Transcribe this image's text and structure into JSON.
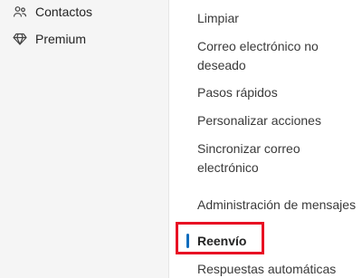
{
  "left_nav": {
    "items": [
      {
        "label": "Contactos",
        "icon": "people-icon"
      },
      {
        "label": "Premium",
        "icon": "diamond-icon"
      }
    ]
  },
  "settings_menu": {
    "items": [
      {
        "label": "Limpiar"
      },
      {
        "label": "Correo electrónico no deseado"
      },
      {
        "label": "Pasos rápidos"
      },
      {
        "label": "Personalizar acciones"
      },
      {
        "label": "Sincronizar correo electrónico"
      },
      {
        "label": "Administración de mensajes"
      },
      {
        "label": "Reenvío",
        "selected": true
      },
      {
        "label": "Respuestas automáticas"
      }
    ]
  },
  "colors": {
    "selection_indicator": "#0f6cbd",
    "highlight_box": "#e81123"
  }
}
